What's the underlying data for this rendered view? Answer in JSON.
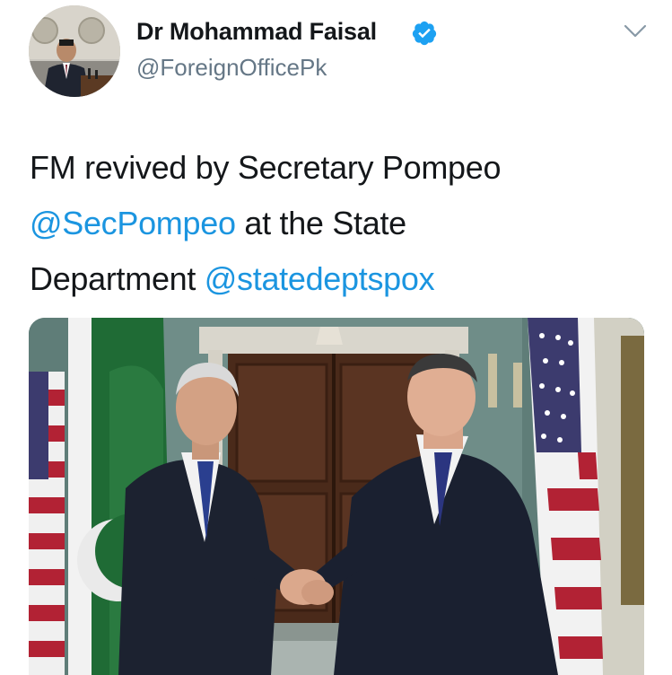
{
  "author": {
    "display_name": "Dr Mohammad Faisal",
    "handle": "@ForeignOfficePk",
    "verified": true
  },
  "tweet": {
    "text_part1": "FM revived by Secretary Pompeo",
    "mention1": "@SecPompeo",
    "text_part2": " at the State",
    "text_part3": "Department ",
    "mention2": "@statedeptspox"
  },
  "colors": {
    "link": "#1b95e0",
    "verified": "#1da1f2",
    "secondary_text": "#657786"
  },
  "icons": {
    "verified": "verified-badge-icon",
    "menu": "chevron-down-icon"
  }
}
